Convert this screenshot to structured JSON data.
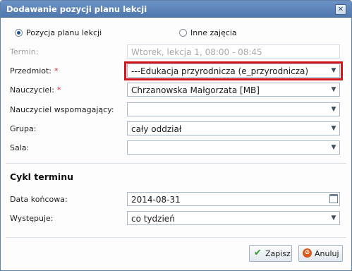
{
  "dialog": {
    "title": "Dodawanie pozycji planu lekcji",
    "close_glyph": "✕"
  },
  "radio": {
    "option1": {
      "label": "Pozycja planu lekcji",
      "checked": true
    },
    "option2": {
      "label": "Inne zajęcia",
      "checked": false
    }
  },
  "form": {
    "termin": {
      "label": "Termin:",
      "value": "Wtorek, lekcja 1, 08:00 - 08:45",
      "disabled": true
    },
    "przedmiot": {
      "label": "Przedmiot:",
      "required_mark": "*",
      "value": "---Edukacja przyrodnicza (e_przyrodnicza)"
    },
    "nauczyciel": {
      "label": "Nauczyciel:",
      "required_mark": "*",
      "value": "Chrzanowska Małgorzata [MB]"
    },
    "nauczyciel_wsp": {
      "label": "Nauczyciel wspomagający:",
      "value": ""
    },
    "grupa": {
      "label": "Grupa:",
      "value": "cały oddział"
    },
    "sala": {
      "label": "Sala:",
      "value": ""
    }
  },
  "cykl": {
    "title": "Cykl terminu",
    "data_koncowa": {
      "label": "Data końcowa:",
      "value": "2014-08-31"
    },
    "wystepuje": {
      "label": "Występuje:",
      "value": "co tydzień"
    }
  },
  "buttons": {
    "save": "Zapisz",
    "cancel": "Anuluj"
  },
  "icons": {
    "dropdown": "chevron-down-icon",
    "calendar": "calendar-icon",
    "save": "check-icon",
    "cancel": "cancel-icon"
  },
  "colors": {
    "titlebar": "#5a82b8",
    "highlight": "#d4141b",
    "required": "#d21919"
  }
}
